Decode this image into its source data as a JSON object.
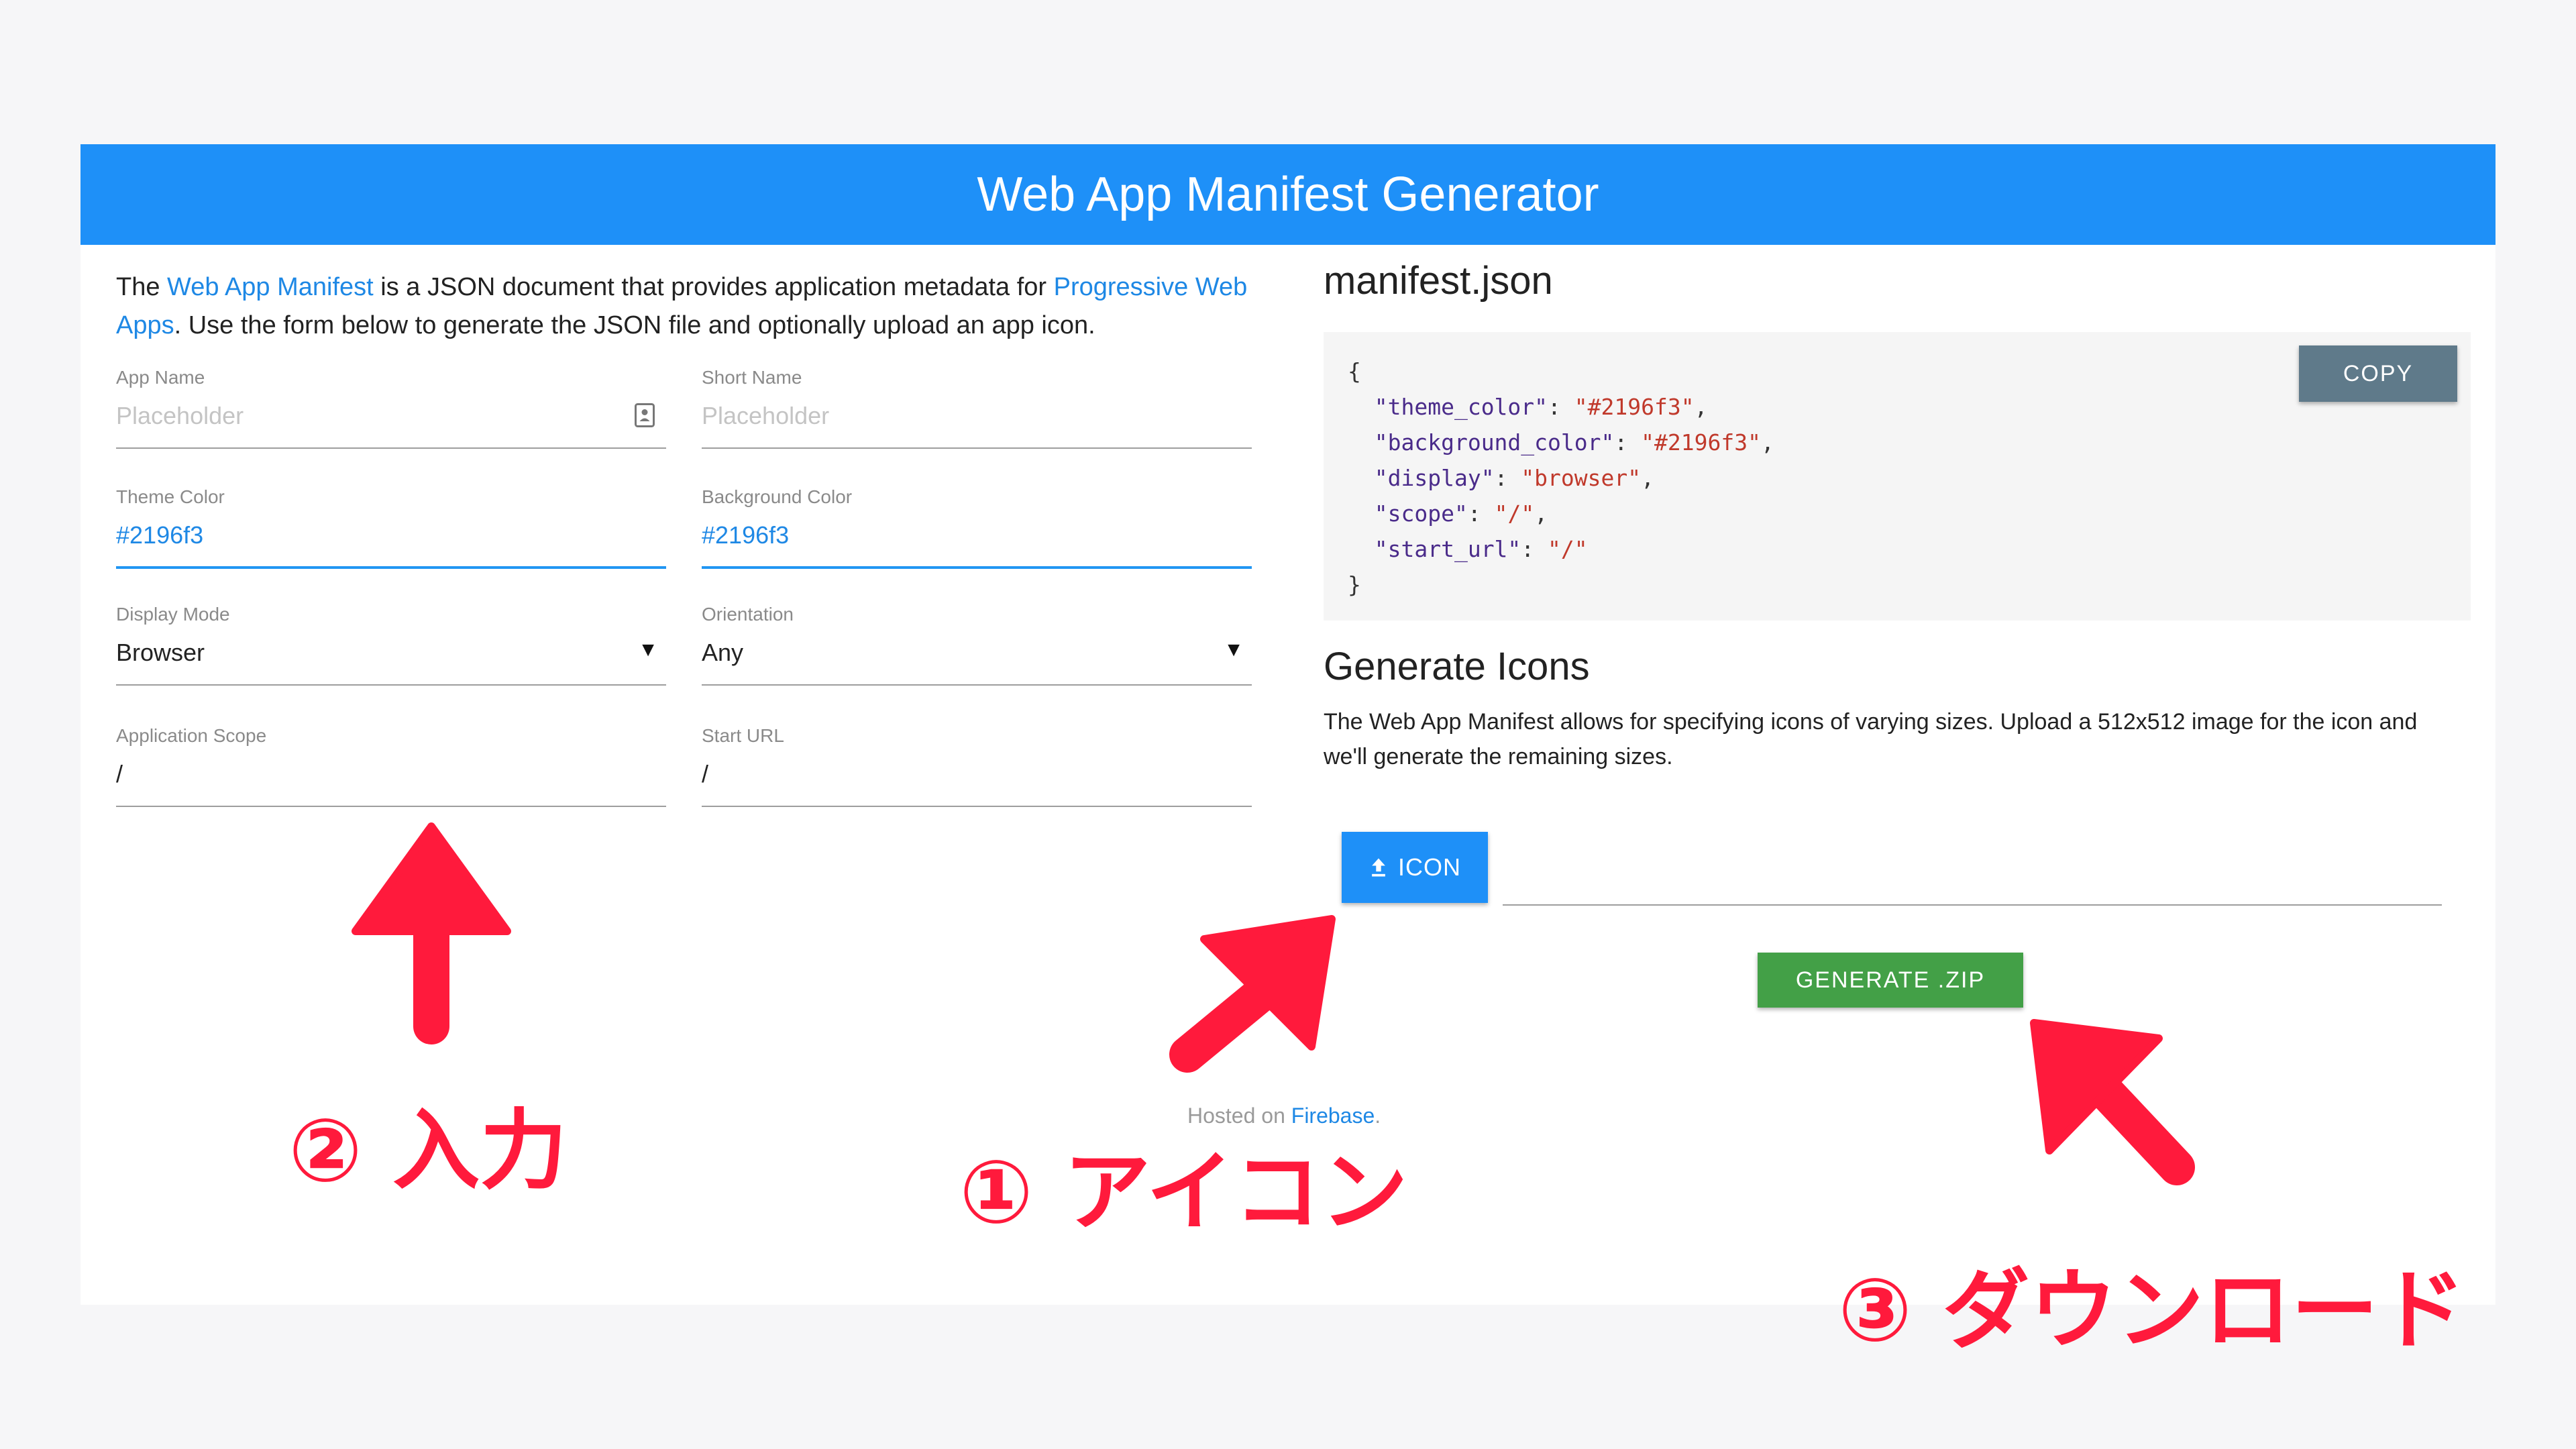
{
  "header": {
    "title": "Web App Manifest Generator"
  },
  "intro": {
    "text1": "The ",
    "link1": "Web App Manifest",
    "text2": " is a JSON document that provides application metadata for ",
    "link2": "Progressive Web Apps",
    "text3": ". Use the form below to generate the JSON file and optionally upload an app icon."
  },
  "form": {
    "app_name": {
      "label": "App Name",
      "placeholder": "Placeholder"
    },
    "short_name": {
      "label": "Short Name",
      "placeholder": "Placeholder"
    },
    "theme_color": {
      "label": "Theme Color",
      "value": "#2196f3"
    },
    "background_color": {
      "label": "Background Color",
      "value": "#2196f3"
    },
    "display_mode": {
      "label": "Display Mode",
      "value": "Browser"
    },
    "orientation": {
      "label": "Orientation",
      "value": "Any"
    },
    "scope": {
      "label": "Application Scope",
      "value": "/"
    },
    "start_url": {
      "label": "Start URL",
      "value": "/"
    }
  },
  "manifest": {
    "title": "manifest.json",
    "copy_label": "COPY",
    "entries": [
      {
        "key": "\"theme_color\"",
        "value": "\"#2196f3\"",
        "sep": ","
      },
      {
        "key": "\"background_color\"",
        "value": "\"#2196f3\"",
        "sep": ","
      },
      {
        "key": "\"display\"",
        "value": "\"browser\"",
        "sep": ","
      },
      {
        "key": "\"scope\"",
        "value": "\"/\"",
        "sep": ","
      },
      {
        "key": "\"start_url\"",
        "value": "\"/\"",
        "sep": ""
      }
    ]
  },
  "icons": {
    "title": "Generate Icons",
    "description": "The Web App Manifest allows for specifying icons of varying sizes. Upload a 512x512 image for the icon and we'll generate the remaining sizes.",
    "icon_button": "ICON",
    "zip_button": "GENERATE .ZIP"
  },
  "footer": {
    "text": "Hosted on ",
    "link": "Firebase",
    "end": "."
  },
  "annotations": {
    "step1": "① アイコン",
    "step2": "② 入力",
    "step3": "③ ダウンロード",
    "color": "#ff1a3c"
  },
  "colors": {
    "header": "#1e90f8",
    "accent": "#2196f3",
    "zip": "#43a047",
    "copy": "#5f7a8a"
  }
}
